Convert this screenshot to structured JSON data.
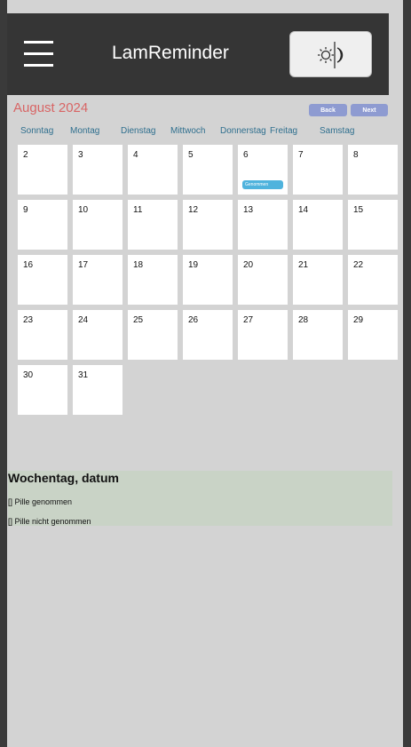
{
  "header": {
    "title": "LamReminder",
    "menu_icon": "hamburger-menu-icon",
    "theme_icon": "sun-moon-toggle-icon"
  },
  "calendar": {
    "month_title": "August 2024",
    "back_label": "Back",
    "next_label": "Next",
    "weekdays": [
      "Sonntag",
      "Montag",
      "Dienstag",
      "Mittwoch",
      "Donnerstag",
      "Freitag",
      "Samstag"
    ],
    "days": [
      "2",
      "3",
      "4",
      "5",
      "6",
      "7",
      "8",
      "9",
      "10",
      "11",
      "12",
      "13",
      "14",
      "15",
      "16",
      "17",
      "18",
      "19",
      "20",
      "21",
      "22",
      "23",
      "24",
      "25",
      "26",
      "27",
      "28",
      "29",
      "30",
      "31"
    ],
    "event": {
      "day": "6",
      "label": "Genommen"
    }
  },
  "detail": {
    "title": "Wochentag, datum",
    "lines": [
      "[] Pille genommen",
      "[] Pille nicht genommen"
    ]
  },
  "colors": {
    "header_bg": "#353535",
    "page_bg": "#d3d3d3",
    "month_title": "#d86565",
    "weekday_text": "#2f6f8e",
    "nav_button": "#8e9bd1",
    "event_badge": "#4fb3dd",
    "detail_bg": "#c9d3c6"
  }
}
